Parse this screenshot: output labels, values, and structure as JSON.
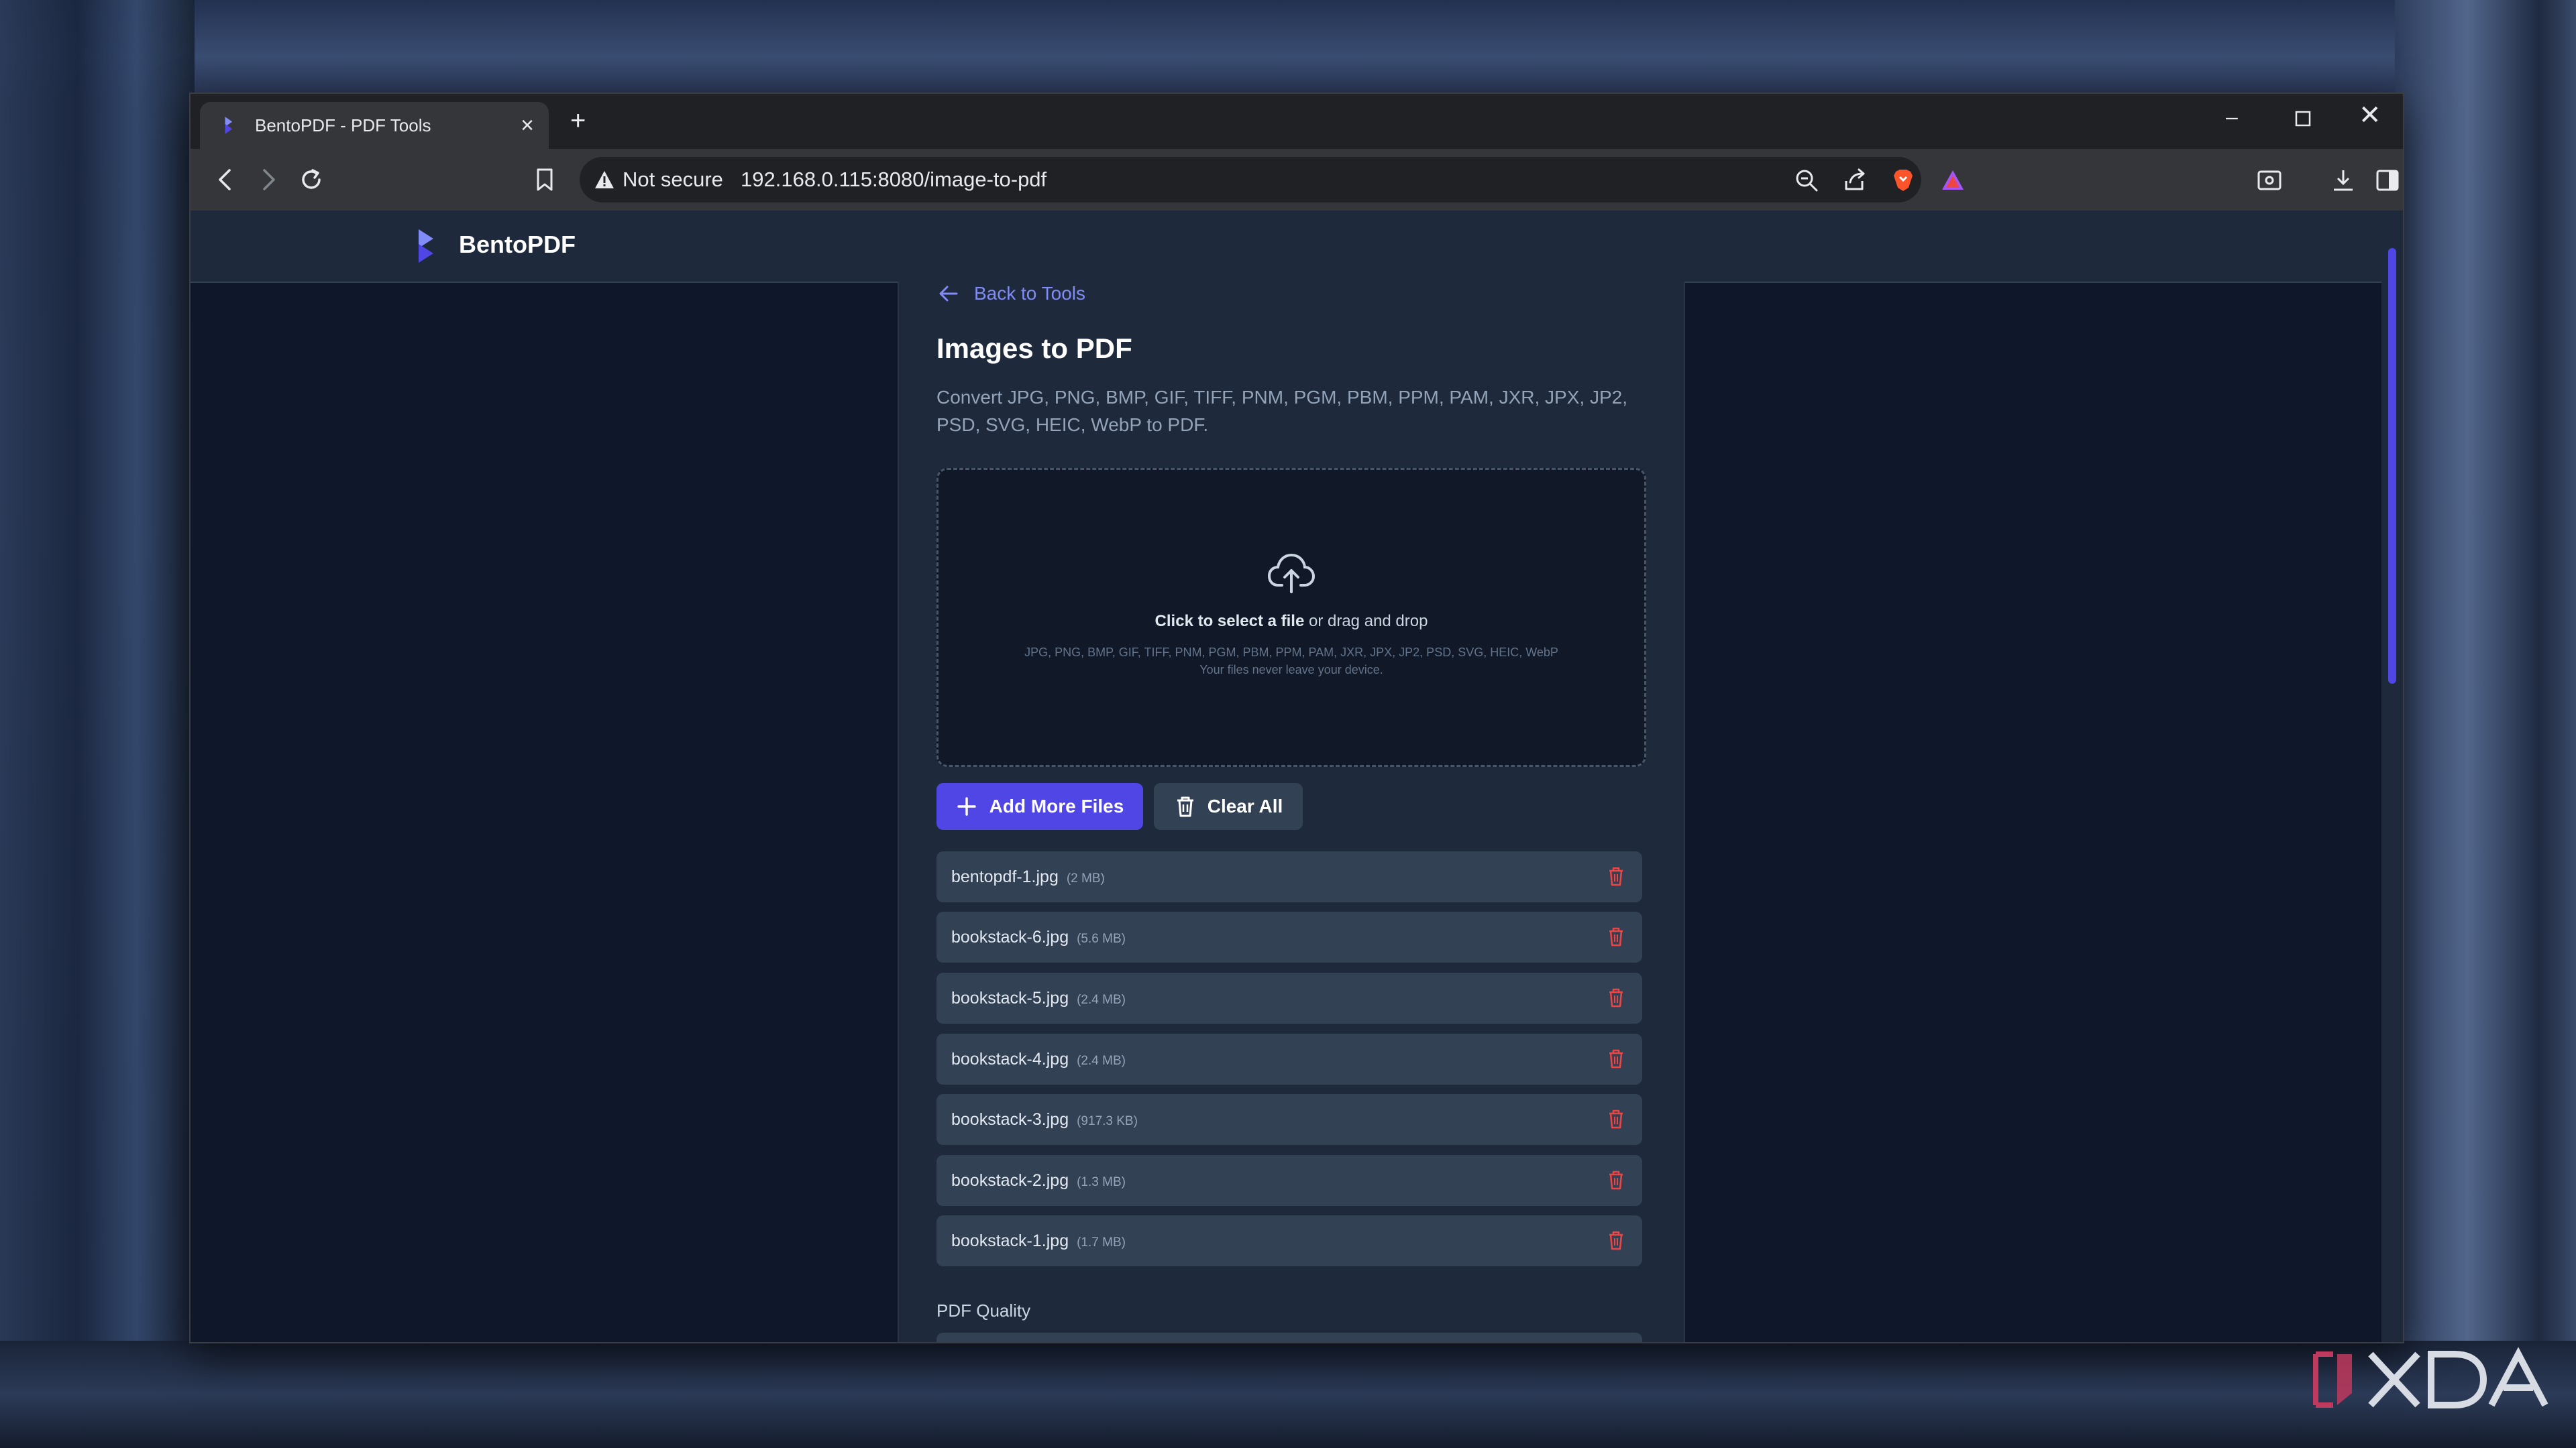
{
  "browser": {
    "tab_title": "BentoPDF - PDF Tools",
    "not_secure": "Not secure",
    "url": "192.168.0.115:8080/image-to-pdf"
  },
  "site": {
    "brand": "BentoPDF",
    "back_label": "Back to Tools",
    "title": "Images to PDF",
    "description": "Convert JPG, PNG, BMP, GIF, TIFF, PNM, PGM, PBM, PPM, PAM, JXR, JPX, JP2, PSD, SVG, HEIC, WebP to PDF.",
    "dropzone": {
      "click_text": "Click to select a file",
      "or_text": " or drag and drop",
      "formats": "JPG, PNG, BMP, GIF, TIFF, PNM, PGM, PBM, PPM, PAM, JXR, JPX, JP2, PSD, SVG, HEIC, WebP",
      "privacy": "Your files never leave your device."
    },
    "add_more_label": "Add More Files",
    "clear_all_label": "Clear All",
    "files": [
      {
        "name": "bentopdf-1.jpg",
        "size": "(2 MB)"
      },
      {
        "name": "bookstack-6.jpg",
        "size": "(5.6 MB)"
      },
      {
        "name": "bookstack-5.jpg",
        "size": "(2.4 MB)"
      },
      {
        "name": "bookstack-4.jpg",
        "size": "(2.4 MB)"
      },
      {
        "name": "bookstack-3.jpg",
        "size": "(917.3 KB)"
      },
      {
        "name": "bookstack-2.jpg",
        "size": "(1.3 MB)"
      },
      {
        "name": "bookstack-1.jpg",
        "size": "(1.7 MB)"
      }
    ],
    "quality_label": "PDF Quality"
  },
  "colors": {
    "accent": "#4f46e5",
    "link": "#818cf8",
    "delete": "#ef4444",
    "page_bg": "#0f172a",
    "panel_bg": "#1e293b"
  },
  "watermark": "XDA"
}
